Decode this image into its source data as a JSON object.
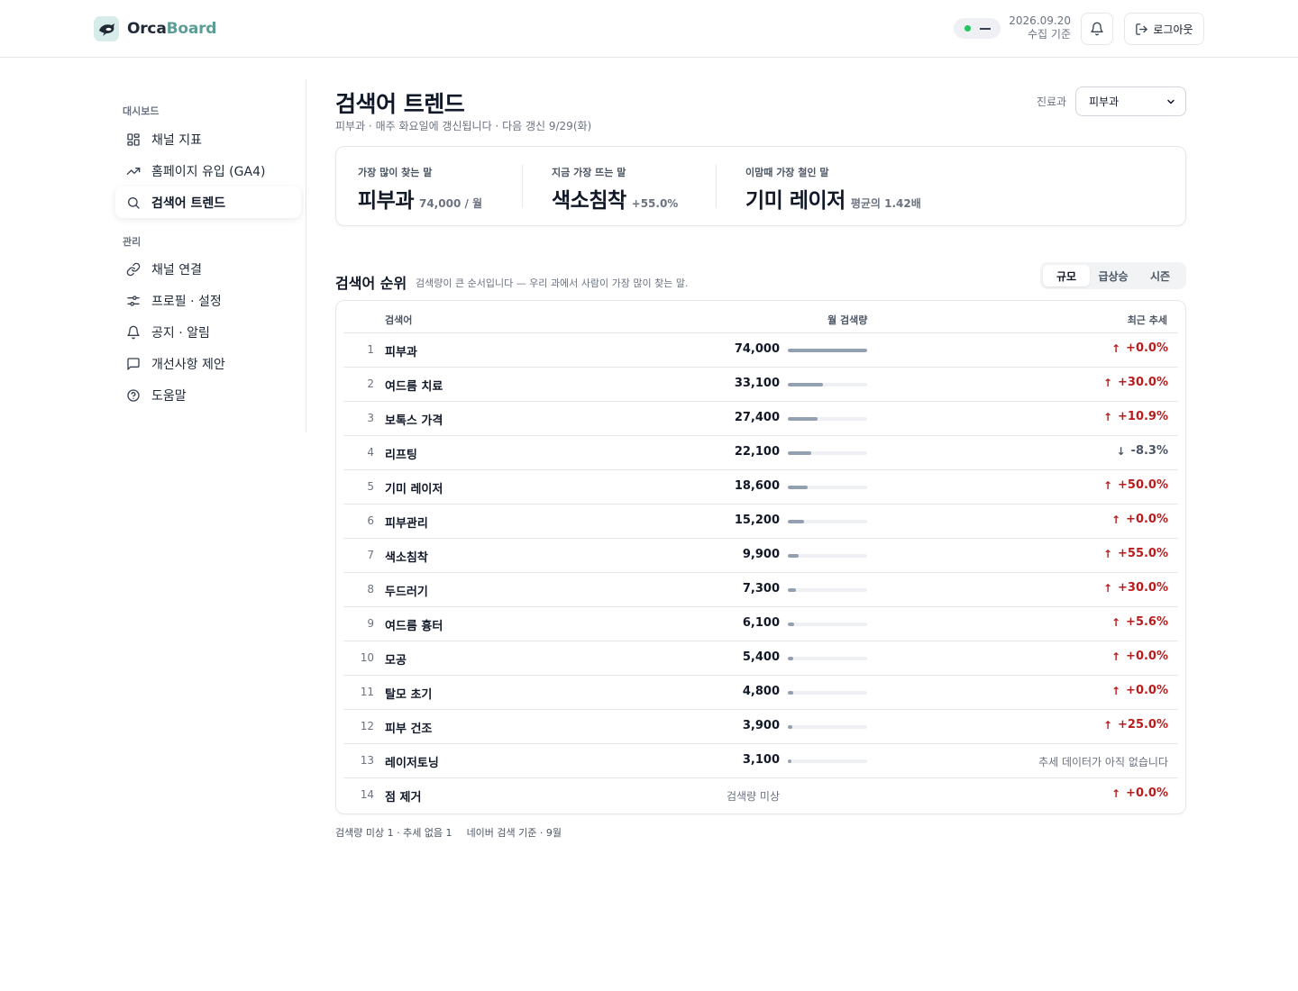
{
  "header": {
    "logo_part1": "Orca",
    "logo_part2": "Board",
    "status": "—",
    "date": "2026.09.20",
    "date_caption": "수집 기준",
    "logout_label": "로그아웃"
  },
  "sidebar": {
    "section_dashboard": "대시보드",
    "section_manage": "관리",
    "dashboard_items": [
      {
        "label": "채널 지표",
        "icon": "grid-icon"
      },
      {
        "label": "홈페이지 유입 (GA4)",
        "icon": "trending-up-icon"
      },
      {
        "label": "검색어 트렌드",
        "icon": "search-icon",
        "active": true
      }
    ],
    "manage_items": [
      {
        "label": "채널 연결",
        "icon": "link-icon"
      },
      {
        "label": "프로필 · 설정",
        "icon": "sliders-icon"
      },
      {
        "label": "공지 · 알림",
        "icon": "bell-icon"
      },
      {
        "label": "개선사항 제안",
        "icon": "message-icon"
      },
      {
        "label": "도움말",
        "icon": "help-circle-icon"
      }
    ]
  },
  "page": {
    "title": "검색어 트렌드",
    "subtitle": "피부과 · 매주 화요일에 갱신됩니다 · 다음 갱신 9/29(화)",
    "select_label": "진료과",
    "select_value": "피부과"
  },
  "kpis": [
    {
      "label": "가장 많이 찾는 말",
      "value": "피부과",
      "sub": "74,000 / 월"
    },
    {
      "label": "지금 가장 뜨는 말",
      "value": "색소침착",
      "sub": "+55.0%"
    },
    {
      "label": "이맘때 가장 철인 말",
      "value": "기미 레이저",
      "sub": "평균의 1.42배"
    }
  ],
  "ranking": {
    "title": "검색어 순위",
    "description": "검색량이 큰 순서입니다 — 우리 과에서 사람이 가장 많이 찾는 말.",
    "tabs": [
      "규모",
      "급상승",
      "시즌"
    ],
    "active_tab": 0,
    "columns": {
      "term": "검색어",
      "volume": "월 검색량",
      "trend": "최근 추세"
    },
    "rows": [
      {
        "rank": "1",
        "term": "피부과",
        "volume": "74,000",
        "volume_ratio": 1.0,
        "trend": "+0.0%",
        "dir": "up"
      },
      {
        "rank": "2",
        "term": "여드름 치료",
        "volume": "33,100",
        "volume_ratio": 0.447,
        "trend": "+30.0%",
        "dir": "up"
      },
      {
        "rank": "3",
        "term": "보톡스 가격",
        "volume": "27,400",
        "volume_ratio": 0.37,
        "trend": "+10.9%",
        "dir": "up"
      },
      {
        "rank": "4",
        "term": "리프팅",
        "volume": "22,100",
        "volume_ratio": 0.299,
        "trend": "-8.3%",
        "dir": "down"
      },
      {
        "rank": "5",
        "term": "기미 레이저",
        "volume": "18,600",
        "volume_ratio": 0.251,
        "trend": "+50.0%",
        "dir": "up"
      },
      {
        "rank": "6",
        "term": "피부관리",
        "volume": "15,200",
        "volume_ratio": 0.205,
        "trend": "+0.0%",
        "dir": "up"
      },
      {
        "rank": "7",
        "term": "색소침착",
        "volume": "9,900",
        "volume_ratio": 0.134,
        "trend": "+55.0%",
        "dir": "up"
      },
      {
        "rank": "8",
        "term": "두드러기",
        "volume": "7,300",
        "volume_ratio": 0.099,
        "trend": "+30.0%",
        "dir": "up"
      },
      {
        "rank": "9",
        "term": "여드름 흉터",
        "volume": "6,100",
        "volume_ratio": 0.082,
        "trend": "+5.6%",
        "dir": "up"
      },
      {
        "rank": "10",
        "term": "모공",
        "volume": "5,400",
        "volume_ratio": 0.073,
        "trend": "+0.0%",
        "dir": "up"
      },
      {
        "rank": "11",
        "term": "탈모 초기",
        "volume": "4,800",
        "volume_ratio": 0.065,
        "trend": "+0.0%",
        "dir": "up"
      },
      {
        "rank": "12",
        "term": "피부 건조",
        "volume": "3,900",
        "volume_ratio": 0.053,
        "trend": "+25.0%",
        "dir": "up"
      },
      {
        "rank": "13",
        "term": "레이저토닝",
        "volume": "3,100",
        "volume_ratio": 0.042,
        "trend": "추세 데이터가 아직 없습니다",
        "dir": "none"
      },
      {
        "rank": "14",
        "term": "점 제거",
        "volume": "검색량 미상",
        "volume_ratio": null,
        "trend": "+0.0%",
        "dir": "up"
      }
    ]
  },
  "footnote": {
    "left": "검색량 미상 1 · 추세 없음 1",
    "right": "네이버 검색 기준 · 9월"
  },
  "colors": {
    "accent": "#5c9e96",
    "trend_up": "#b91c1c",
    "status_dot": "#22c55e",
    "bar_fill": "#94a0b1"
  }
}
